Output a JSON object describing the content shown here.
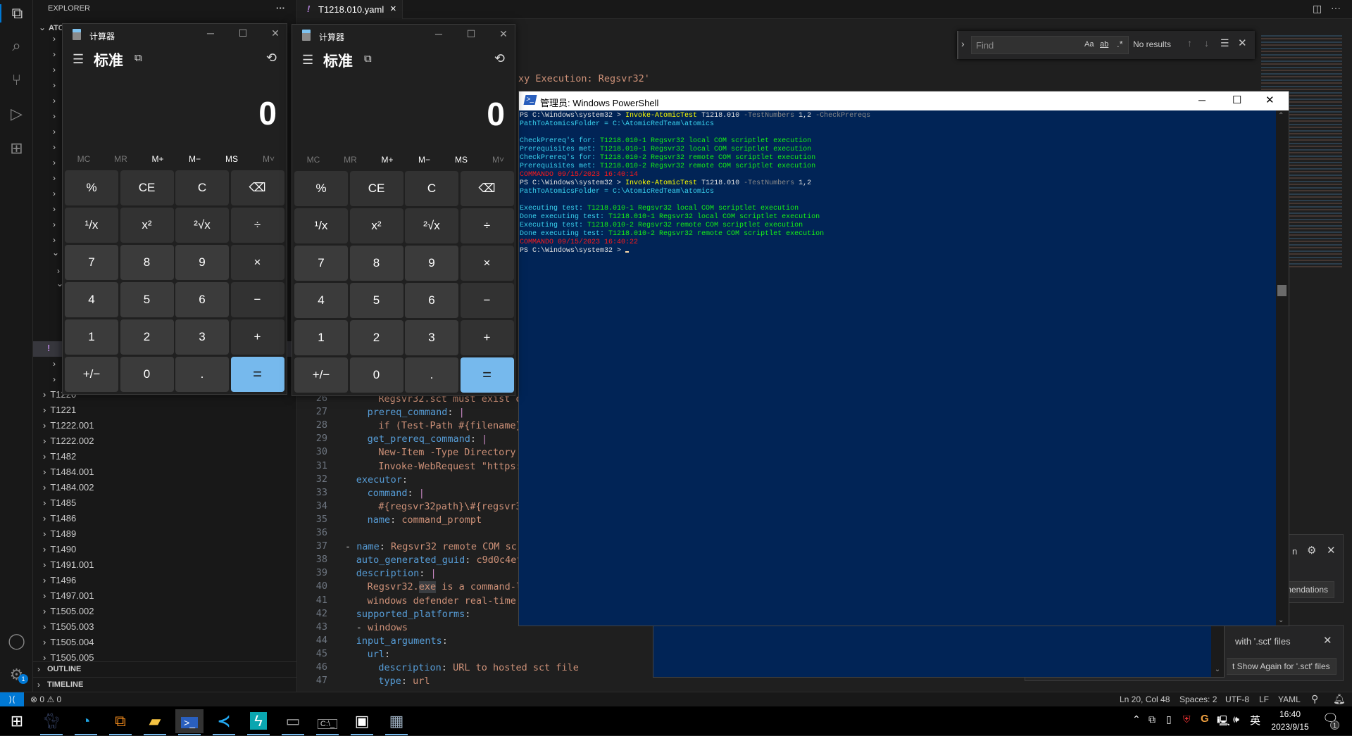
{
  "activity_bar": {
    "icons": [
      "files-icon",
      "search-icon",
      "source-control-icon",
      "run-debug-icon",
      "extensions-icon",
      "account-icon",
      "gear-icon"
    ],
    "gear_badge": "1"
  },
  "sidebar": {
    "title": "EXPLORER",
    "more": "···",
    "root": "ATO",
    "items": [
      "T1220",
      "T1221",
      "T1222.001",
      "T1222.002",
      "T1482",
      "T1484.001",
      "T1484.002",
      "T1485",
      "T1486",
      "T1489",
      "T1490",
      "T1491.001",
      "T1496",
      "T1497.001",
      "T1505.002",
      "T1505.003",
      "T1505.004",
      "T1505.005"
    ],
    "outline": "OUTLINE",
    "timeline": "TIMELINE"
  },
  "editor": {
    "tab": {
      "label": "T1218.010.yaml",
      "icon": "!",
      "close": "×"
    },
    "line2_fragment": "xy Execution: Regsvr32'",
    "lines": [
      {
        "n": "26",
        "indent": 6,
        "dash": "",
        "key": "",
        "val": "Regsvr32.sct must exist on"
      },
      {
        "n": "27",
        "indent": 4,
        "dash": "",
        "key": "prereq_command",
        "val": "|"
      },
      {
        "n": "28",
        "indent": 6,
        "dash": "",
        "key": "",
        "val": "if (Test-Path #{filename})"
      },
      {
        "n": "29",
        "indent": 4,
        "dash": "",
        "key": "get_prereq_command",
        "val": "|"
      },
      {
        "n": "30",
        "indent": 6,
        "dash": "",
        "key": "",
        "val": "New-Item -Type Directory ("
      },
      {
        "n": "31",
        "indent": 6,
        "dash": "",
        "key": "",
        "val": "Invoke-WebRequest \"https:/"
      },
      {
        "n": "32",
        "indent": 2,
        "dash": "",
        "key": "executor",
        "val": ""
      },
      {
        "n": "33",
        "indent": 4,
        "dash": "",
        "key": "command",
        "val": "|"
      },
      {
        "n": "34",
        "indent": 6,
        "dash": "",
        "key": "",
        "val": "#{regsvr32path}\\#{regsvr32"
      },
      {
        "n": "35",
        "indent": 4,
        "dash": "",
        "key": "name",
        "val": "command_prompt"
      },
      {
        "n": "36",
        "indent": 0,
        "dash": "",
        "key": "",
        "val": ""
      },
      {
        "n": "37",
        "indent": 0,
        "dash": "- ",
        "key": "name",
        "val": "Regsvr32 remote COM scri"
      },
      {
        "n": "38",
        "indent": 2,
        "dash": "",
        "key": "auto_generated_guid",
        "val": "c9d0c4ef-"
      },
      {
        "n": "39",
        "indent": 2,
        "dash": "",
        "key": "description",
        "val": "|"
      },
      {
        "n": "40",
        "indent": 4,
        "dash": "",
        "key": "",
        "val": "Regsvr32.exe is a command-li"
      },
      {
        "n": "41",
        "indent": 4,
        "dash": "",
        "key": "",
        "val": "windows defender real-time p"
      },
      {
        "n": "42",
        "indent": 2,
        "dash": "",
        "key": "supported_platforms",
        "val": ""
      },
      {
        "n": "43",
        "indent": 2,
        "dash": "- ",
        "key": "",
        "val": "windows"
      },
      {
        "n": "44",
        "indent": 2,
        "dash": "",
        "key": "input_arguments",
        "val": ""
      },
      {
        "n": "45",
        "indent": 4,
        "dash": "",
        "key": "url",
        "val": ""
      },
      {
        "n": "46",
        "indent": 6,
        "dash": "",
        "key": "description",
        "val": "URL to hosted sct file"
      },
      {
        "n": "47",
        "indent": 6,
        "dash": "",
        "key": "type",
        "val": "url"
      }
    ]
  },
  "find": {
    "placeholder": "Find",
    "match_case": "Aa",
    "whole_word": "ab",
    "regex": ".*",
    "result": "No results"
  },
  "calculators": [
    {
      "title": "计算器",
      "mode": "标准",
      "display": "0"
    },
    {
      "title": "计算器",
      "mode": "标准",
      "display": "0"
    }
  ],
  "calc_memory": [
    "MC",
    "MR",
    "M+",
    "M−",
    "MS",
    "M˅"
  ],
  "calc_buttons": [
    "%",
    "CE",
    "C",
    "⌫",
    "¹/x",
    "x²",
    "²√x",
    "÷",
    "7",
    "8",
    "9",
    "×",
    "4",
    "5",
    "6",
    "−",
    "1",
    "2",
    "3",
    "+",
    "+/−",
    "0",
    ".",
    "="
  ],
  "powershell": {
    "title": "管理员: Windows PowerShell",
    "lines": [
      [
        {
          "t": "PS C:\\Windows\\system32 > ",
          "c": "w"
        },
        {
          "t": "Invoke-AtomicTest",
          "c": "y"
        },
        {
          "t": " T1218.010 ",
          "c": "w"
        },
        {
          "t": "-TestNumbers",
          "c": "g"
        },
        {
          "t": " 1,2 ",
          "c": "w"
        },
        {
          "t": "-CheckPrereqs",
          "c": "g"
        }
      ],
      [
        {
          "t": "PathToAtomicsFolder = C:\\AtomicRedTeam\\atomics",
          "c": "c"
        }
      ],
      [],
      [
        {
          "t": "CheckPrereq's for: ",
          "c": "c"
        },
        {
          "t": "T1218.010-1 Regsvr32 local COM scriptlet execution",
          "c": "gr"
        }
      ],
      [
        {
          "t": "Prerequisites met: ",
          "c": "c"
        },
        {
          "t": "T1218.010-1 Regsvr32 local COM scriptlet execution",
          "c": "gr"
        }
      ],
      [
        {
          "t": "CheckPrereq's for: ",
          "c": "c"
        },
        {
          "t": "T1218.010-2 Regsvr32 remote COM scriptlet execution",
          "c": "gr"
        }
      ],
      [
        {
          "t": "Prerequisites met: ",
          "c": "c"
        },
        {
          "t": "T1218.010-2 Regsvr32 remote COM scriptlet execution",
          "c": "gr"
        }
      ],
      [
        {
          "t": "COMMANDO 09/15/2023 16:40:14",
          "c": "r"
        }
      ],
      [
        {
          "t": "PS C:\\Windows\\system32 > ",
          "c": "w"
        },
        {
          "t": "Invoke-AtomicTest",
          "c": "y"
        },
        {
          "t": " T1218.010 ",
          "c": "w"
        },
        {
          "t": "-TestNumbers",
          "c": "g"
        },
        {
          "t": " 1,2",
          "c": "w"
        }
      ],
      [
        {
          "t": "PathToAtomicsFolder = C:\\AtomicRedTeam\\atomics",
          "c": "c"
        }
      ],
      [],
      [
        {
          "t": "Executing test: ",
          "c": "c"
        },
        {
          "t": "T1218.010-1 Regsvr32 local COM scriptlet execution",
          "c": "gr"
        }
      ],
      [
        {
          "t": "Done executing test: ",
          "c": "c"
        },
        {
          "t": "T1218.010-1 Regsvr32 local COM scriptlet execution",
          "c": "gr"
        }
      ],
      [
        {
          "t": "Executing test: ",
          "c": "c"
        },
        {
          "t": "T1218.010-2 Regsvr32 remote COM scriptlet execution",
          "c": "gr"
        }
      ],
      [
        {
          "t": "Done executing test: ",
          "c": "c"
        },
        {
          "t": "T1218.010-2 Regsvr32 remote COM scriptlet execution",
          "c": "gr"
        }
      ],
      [
        {
          "t": "COMMANDO 09/15/2023 16:40:22",
          "c": "r"
        }
      ],
      [
        {
          "t": "PS C:\\Windows\\system32 > ",
          "c": "w"
        }
      ]
    ]
  },
  "notifications": {
    "toast1_fragment": "n",
    "toast1_button": "mendations",
    "toast2_fragment": "with '.sct' files",
    "toast2_button": "t Show Again for '.sct' files"
  },
  "status_bar": {
    "errors": "0",
    "warnings": "0",
    "position": "Ln 20, Col 48",
    "spaces": "Spaces: 2",
    "encoding": "UTF-8",
    "eol": "LF",
    "language": "YAML"
  },
  "taskbar": {
    "apps": [
      "cat-app-icon",
      "edge-icon",
      "vmware-icon",
      "file-explorer-icon",
      "powershell-icon",
      "vscode-icon",
      "teal-app-icon",
      "resource-monitor-icon",
      "cmd-icon",
      "store-icon",
      "calculator-icon"
    ],
    "ime": "英",
    "time": "16:40",
    "date": "2023/9/15",
    "notification_count": "1"
  },
  "colors": {
    "accent": "#0078d4",
    "powershell_bg": "#012456",
    "calc_equals": "#76b9ed"
  }
}
